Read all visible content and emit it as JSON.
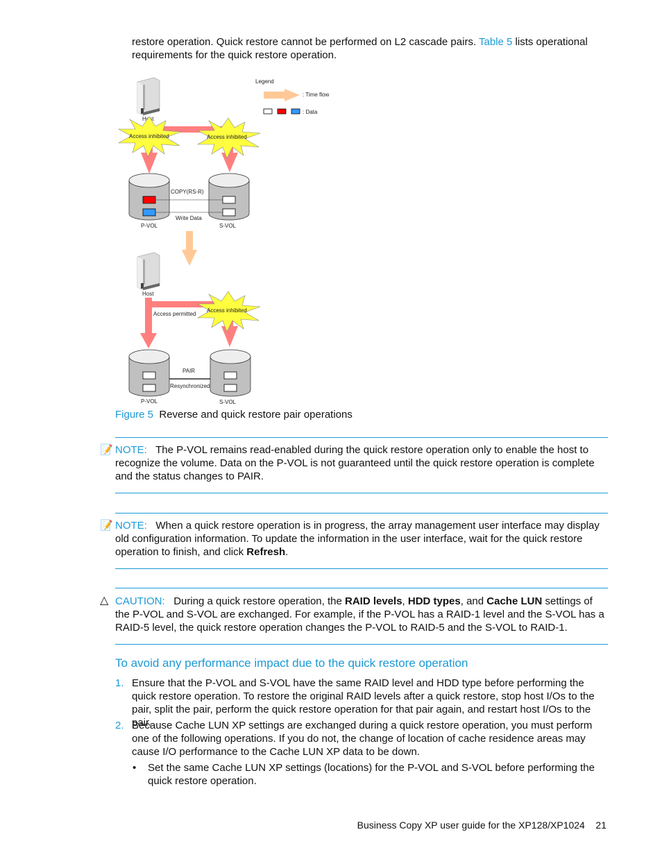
{
  "intro": {
    "before": "restore operation. Quick restore cannot be performed on L2 cascade pairs. ",
    "link": "Table 5",
    "after": " lists operational requirements for the quick restore operation."
  },
  "diagram": {
    "legend_title": "Legend",
    "time_flow": ": Time flow",
    "data": ": Data",
    "host": "Host",
    "access_inhibited": "Access inhibited",
    "access_permitted": "Access permitted",
    "copy": "COPY(RS-R)",
    "write_data": "Write Data",
    "pvol": "P-VOL",
    "svol": "S-VOL",
    "pair": "PAIR",
    "resync": "Resynchronized",
    "colors": {
      "arrow": "#ff7f7f",
      "time_arrow": "#ffc896",
      "burst": "#ffff40",
      "red": "#ff0000",
      "blue": "#3399ff",
      "disk": "#c0c0c0"
    }
  },
  "figure": {
    "label": "Figure 5",
    "caption": "Reverse and quick restore pair operations"
  },
  "note1": {
    "label": "NOTE:",
    "text": "The P-VOL remains read-enabled during the quick restore operation only to enable the host to recognize the volume. Data on the P-VOL is not guaranteed until the quick restore operation is complete and the status changes to PAIR."
  },
  "note2": {
    "label": "NOTE:",
    "text": "When a quick restore operation is in progress, the array management user interface may display old configuration information. To update the information in the user interface, wait for the quick restore operation to finish, and click ",
    "bold": "Refresh",
    "end": "."
  },
  "caution": {
    "label": "CAUTION:",
    "t1": "During a quick restore operation, the ",
    "b1": "RAID levels",
    "t2": ", ",
    "b2": "HDD types",
    "t3": ", and ",
    "b3": "Cache LUN",
    "t4": " settings of the P-VOL and S-VOL are exchanged. For example, if the P-VOL has a RAID-1 level and the S-VOL has a RAID-5 level, the quick restore operation changes the P-VOL to RAID-5 and the S-VOL to RAID-1."
  },
  "section_heading": "To avoid any performance impact due to the quick restore operation",
  "steps": [
    {
      "num": "1.",
      "text": "Ensure that the P-VOL and S-VOL have the same RAID level and HDD type before performing the quick restore operation. To restore the original RAID levels after a quick restore, stop host I/Os to the pair, split the pair, perform the quick restore operation for that pair again, and restart host I/Os to the pair."
    },
    {
      "num": "2.",
      "text": "Because Cache LUN XP settings are exchanged during a quick restore operation, you must perform one of the following operations. If you do not, the change of location of cache residence areas may cause I/O performance to the Cache LUN XP data to be down."
    }
  ],
  "bullet": {
    "mark": "•",
    "text": "Set the same Cache LUN XP settings (locations) for the P-VOL and S-VOL before performing the quick restore operation."
  },
  "footer": {
    "title": "Business Copy XP user guide for the XP128/XP1024",
    "page": "21"
  }
}
